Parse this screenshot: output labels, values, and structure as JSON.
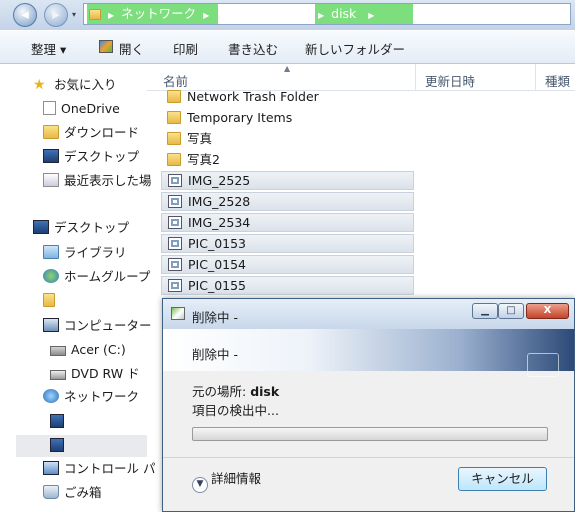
{
  "address": {
    "crumbs": [
      "ネットワーク",
      "",
      "disk"
    ]
  },
  "toolbar": {
    "organize": "整理 ▾",
    "open": "開く",
    "print": "印刷",
    "burn": "書き込む",
    "new_folder": "新しいフォルダー"
  },
  "nav": {
    "favorites": "お気に入り",
    "onedrive": "OneDrive",
    "downloads": "ダウンロード",
    "desktop_fav": "デスクトップ",
    "recent": "最近表示した場",
    "desktop": "デスクトップ",
    "libraries": "ライブラリ",
    "homegroup": "ホームグループ",
    "computer": "コンピューター",
    "drive_c": "Acer (C:)",
    "dvd": "DVD RW ド",
    "network": "ネットワーク",
    "control_panel": "コントロール パ",
    "recycle_bin": "ごみ箱"
  },
  "columns": {
    "name": "名前",
    "date": "更新日時",
    "type": "種類"
  },
  "files": [
    {
      "name": "Network Trash Folder",
      "kind": "folder",
      "selected": false
    },
    {
      "name": "Temporary Items",
      "kind": "folder",
      "selected": false
    },
    {
      "name": "写真",
      "kind": "folder",
      "selected": false
    },
    {
      "name": "写真2",
      "kind": "folder",
      "selected": false
    },
    {
      "name": "IMG_2525",
      "kind": "image",
      "selected": true
    },
    {
      "name": "IMG_2528",
      "kind": "image",
      "selected": true
    },
    {
      "name": "IMG_2534",
      "kind": "image",
      "selected": true
    },
    {
      "name": "PIC_0153",
      "kind": "image",
      "selected": true
    },
    {
      "name": "PIC_0154",
      "kind": "image",
      "selected": true
    },
    {
      "name": "PIC_0155",
      "kind": "image",
      "selected": true
    }
  ],
  "dialog": {
    "title": "削除中 -",
    "heading": "削除中 -",
    "from_label": "元の場所: ",
    "from_value": "disk",
    "status": "項目の検出中...",
    "progress": 0,
    "details": "詳細情報",
    "cancel": "キャンセル",
    "minimize_glyph": "▁",
    "maximize_glyph": "□",
    "close_glyph": "X"
  },
  "colors": {
    "crumb_highlight": "#7dde7d",
    "selection": "#dbe2ea",
    "dialog_banner_dark": "#2c4a78"
  }
}
